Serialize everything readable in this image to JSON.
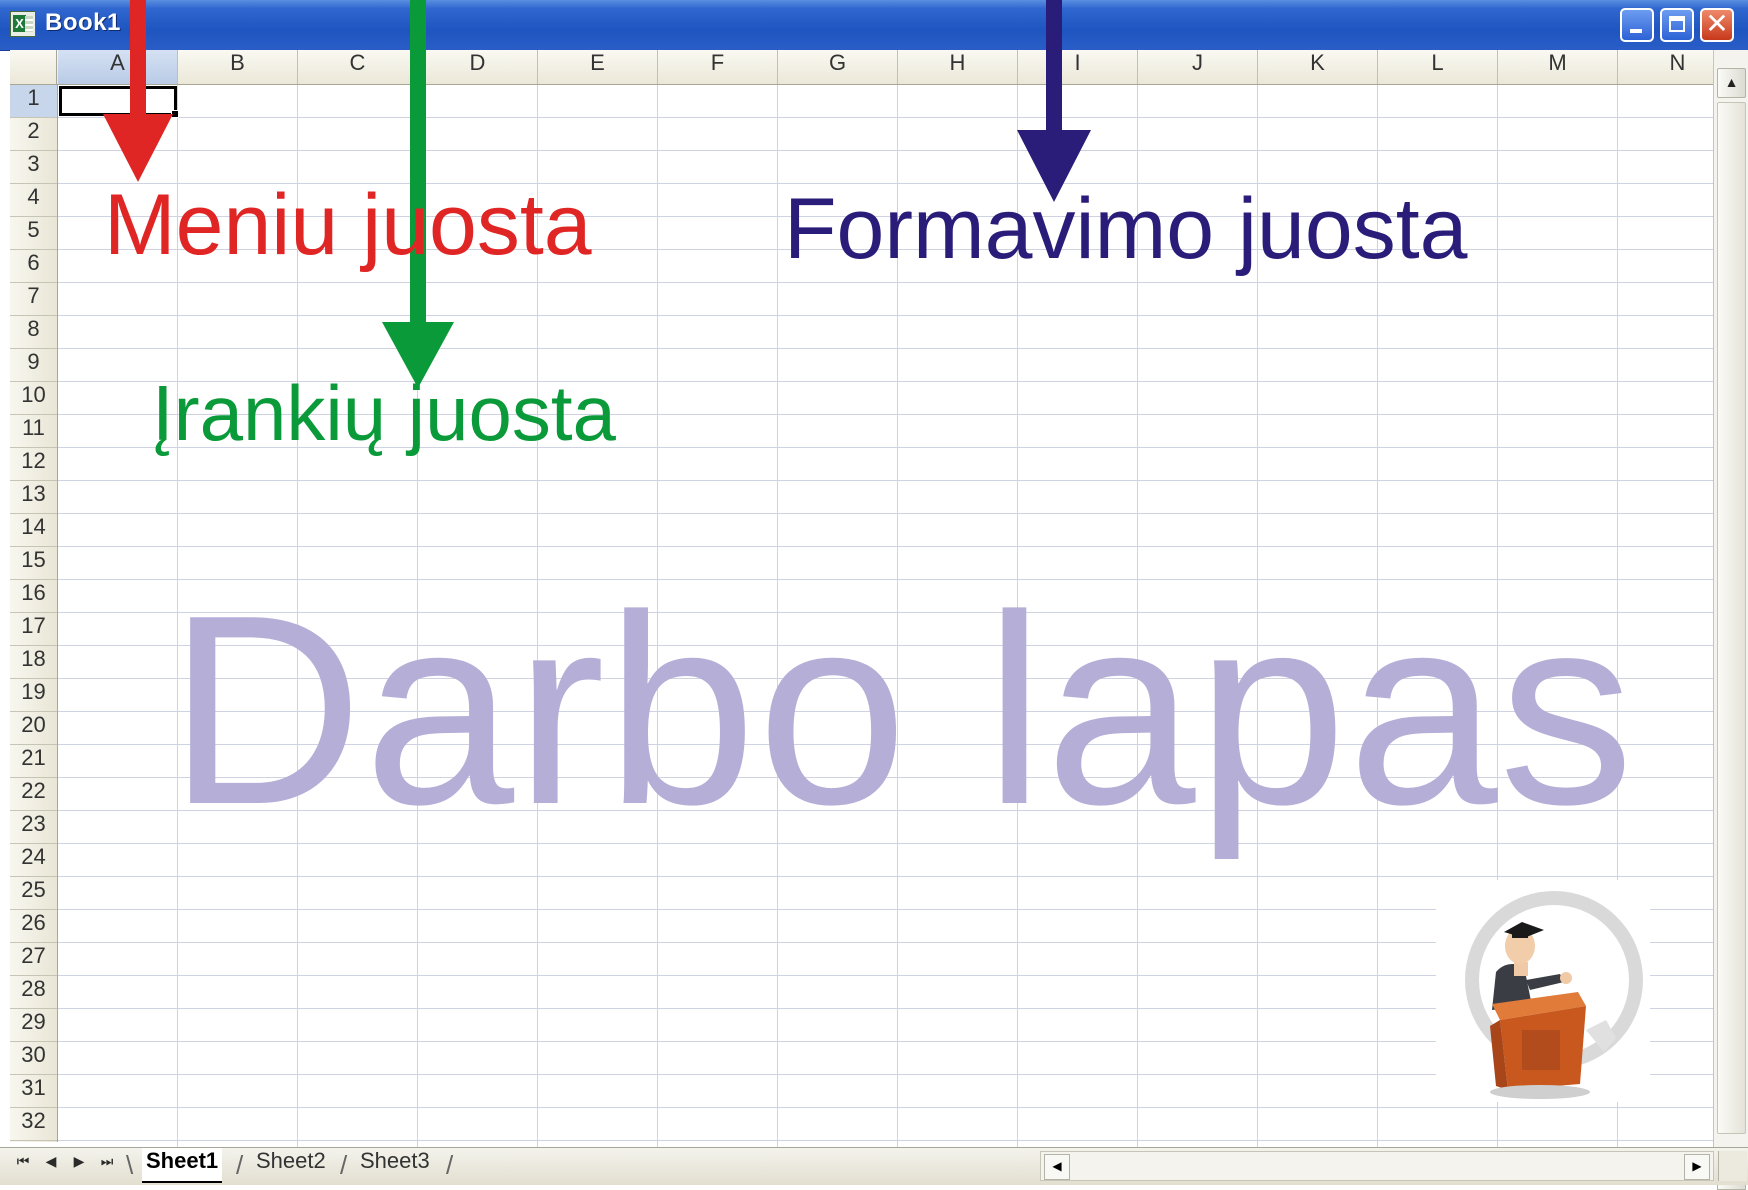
{
  "window": {
    "title": "Book1",
    "icon": "excel-icon",
    "controls": [
      "minimize-icon",
      "maximize-icon",
      "close-icon"
    ]
  },
  "columns": [
    "A",
    "B",
    "C",
    "D",
    "E",
    "F",
    "G",
    "H",
    "I",
    "J",
    "K",
    "L",
    "M",
    "N"
  ],
  "rows": [
    "1",
    "2",
    "3",
    "4",
    "5",
    "6",
    "7",
    "8",
    "9",
    "10",
    "11",
    "12",
    "13",
    "14",
    "15",
    "16",
    "17",
    "18",
    "19",
    "20",
    "21",
    "22",
    "23",
    "24",
    "25",
    "26",
    "27",
    "28",
    "29",
    "30",
    "31",
    "32"
  ],
  "active_cell": "A1",
  "sheets": {
    "tabs": [
      "Sheet1",
      "Sheet2",
      "Sheet3"
    ],
    "active": "Sheet1",
    "nav_icons": [
      "first-sheet-icon",
      "prev-sheet-icon",
      "next-sheet-icon",
      "last-sheet-icon"
    ]
  },
  "annotations": {
    "menu_bar_label": "Meniu juosta",
    "toolbar_label": "Įrankių juosta",
    "formatting_bar_label": "Formavimo juosta",
    "worksheet_label": "Darbo lapas"
  },
  "colors": {
    "menu_bar_arrow": "#e02525",
    "toolbar_arrow": "#0a9a3a",
    "formatting_bar_arrow": "#2a1d7a",
    "worksheet_text": "#b5afd8",
    "title_bar": "#1f55c0"
  },
  "mascot": {
    "icon": "professor-podium-illustration"
  }
}
